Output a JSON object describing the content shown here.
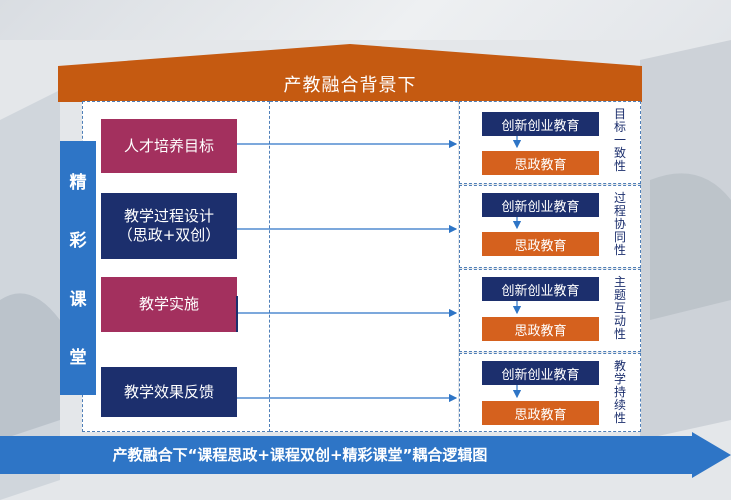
{
  "header": {
    "title": "产教融合背景下"
  },
  "side_bar": {
    "chars": [
      "精",
      "彩",
      "课",
      "堂"
    ]
  },
  "left_boxes": [
    {
      "label": "人才培养目标"
    },
    {
      "label_line1": "教学过程设计",
      "label_line2": "（思政+双创）"
    },
    {
      "label": "教学实施"
    },
    {
      "label": "教学效果反馈"
    }
  ],
  "groups": [
    {
      "top": "创新创业教育",
      "bottom": "思政教育",
      "side": "目标一致性"
    },
    {
      "top": "创新创业教育",
      "bottom": "思政教育",
      "side": "过程协同性"
    },
    {
      "top": "创新创业教育",
      "bottom": "思政教育",
      "side": "主题互动性"
    },
    {
      "top": "创新创业教育",
      "bottom": "思政教育",
      "side": "教学持续性"
    }
  ],
  "footer": {
    "caption": "产教融合下“课程思政+课程双创+精彩课堂”耦合逻辑图"
  },
  "colors": {
    "orange": "#c55a11",
    "navy": "#1c2f6d",
    "crimson": "#a3305e",
    "blue": "#2e75c6",
    "sz_orange": "#d5611e"
  }
}
